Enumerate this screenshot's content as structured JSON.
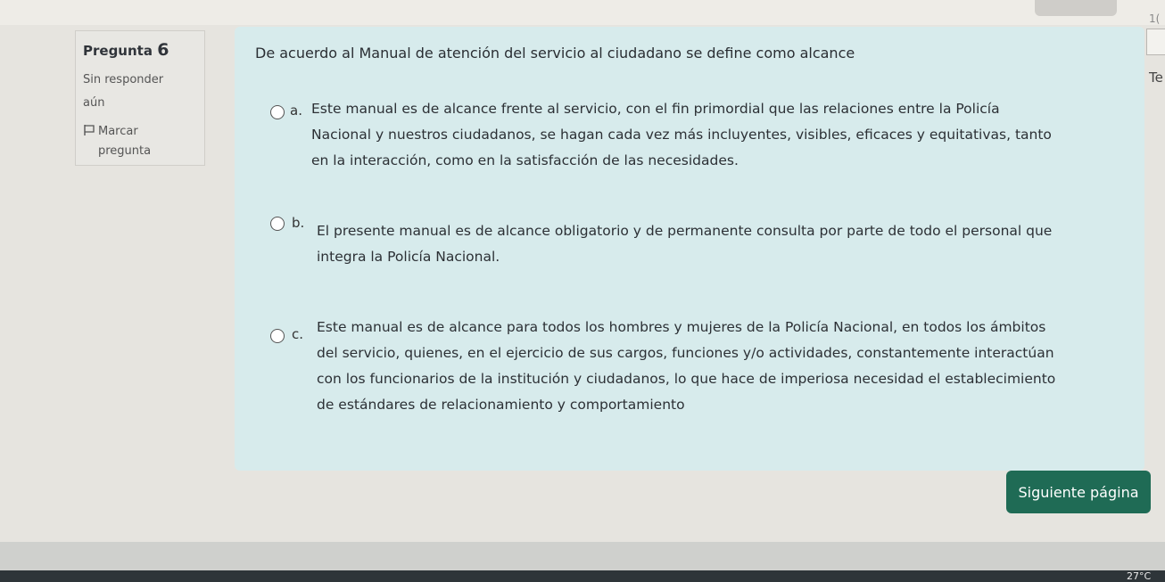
{
  "question": {
    "label": "Pregunta",
    "number": "6",
    "state_line1": "Sin responder",
    "state_line2": "aún",
    "flag_label_line1": "Marcar",
    "flag_label_line2": "pregunta",
    "text": "De acuerdo al Manual de atención del servicio al ciudadano se define como alcance",
    "options": [
      {
        "letter": "a.",
        "lines": [
          "Este manual es de alcance frente al servicio, con el fin primordial que las relaciones entre la Policía",
          "Nacional y nuestros ciudadanos, se hagan cada vez más incluyentes, visibles, eficaces y equitativas, tanto",
          "en la interacción, como en la satisfacción de las necesidades."
        ],
        "selected": false
      },
      {
        "letter": "b.",
        "lines": [
          "El presente manual es de alcance obligatorio y de permanente consulta por parte de todo el personal que",
          "integra la Policía Nacional."
        ],
        "selected": false
      },
      {
        "letter": "c.",
        "lines": [
          "Este manual es de alcance para todos los hombres y mujeres de la Policía Nacional, en todos los ámbitos",
          "del servicio, quienes, en el ejercicio de sus cargos, funciones y/o actividades, constantemente interactúan",
          "con los funcionarios de la institución y ciudadanos, lo que hace de imperiosa necesidad el establecimiento",
          "de estándares de relacionamiento y comportamiento"
        ],
        "selected": false
      }
    ]
  },
  "nav": {
    "next_label": "Siguiente página"
  },
  "edge": {
    "right_partial_text": "Te",
    "top_right_number": "1(",
    "temperature": "27°C"
  },
  "colors": {
    "panel_bg": "#d7ebec",
    "button_bg": "#1f6b55",
    "button_text": "#ffffff"
  }
}
